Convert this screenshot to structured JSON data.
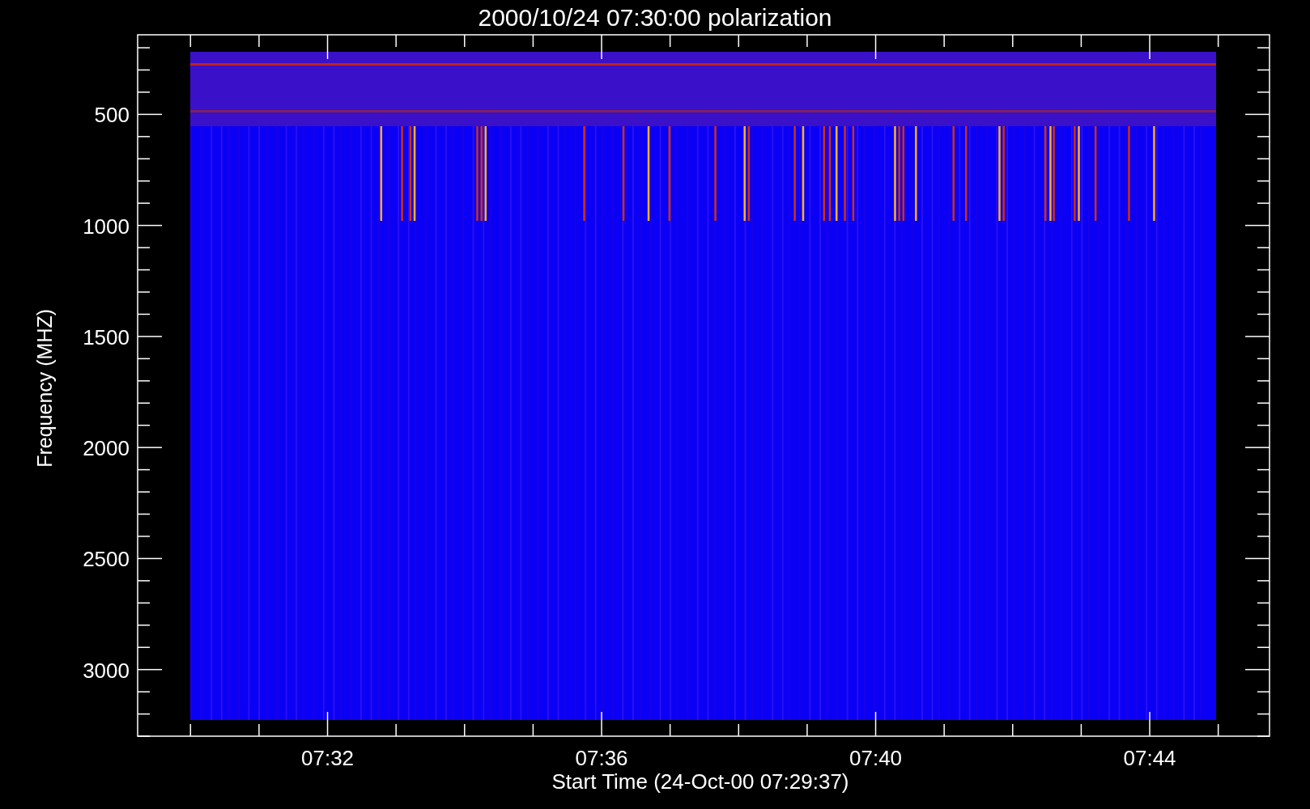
{
  "plot": {
    "title": "2000/10/24 07:30:00 polarization",
    "ylabel": "Frequency (MHZ)",
    "xlabel": "Start Time (24-Oct-00 07:29:37)",
    "yticks": [
      "500",
      "1000",
      "1500",
      "2000",
      "2500",
      "3000"
    ],
    "xticks": [
      "07:32",
      "07:36",
      "07:40",
      "07:44"
    ]
  }
}
